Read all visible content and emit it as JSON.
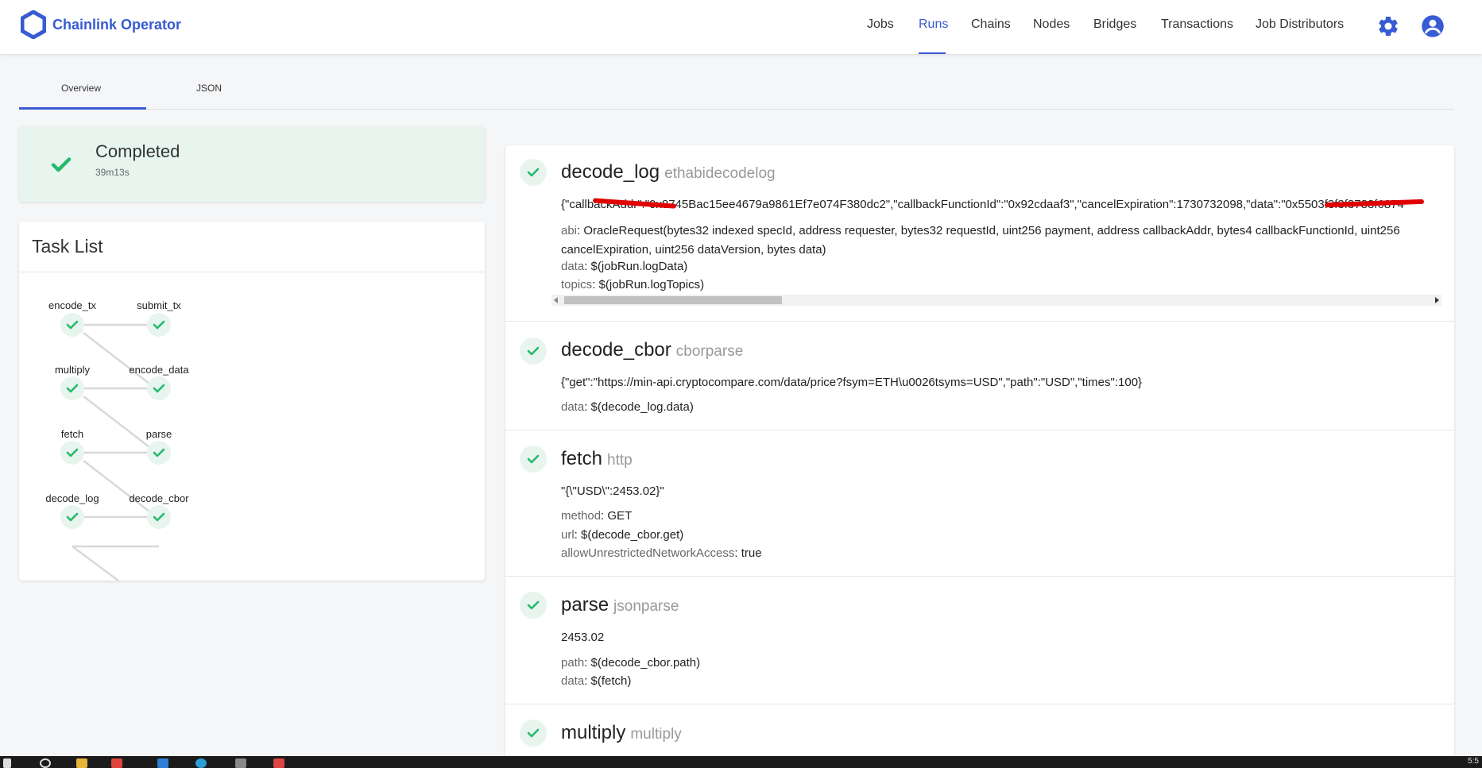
{
  "app": {
    "name": "Chainlink Operator"
  },
  "nav": {
    "items": [
      "Jobs",
      "Runs",
      "Chains",
      "Nodes",
      "Bridges",
      "Transactions",
      "Job Distributors"
    ],
    "active": "Runs"
  },
  "tabs": [
    "Overview",
    "JSON"
  ],
  "status": {
    "label": "Completed",
    "duration": "39m13s"
  },
  "tasklist": {
    "title": "Task List",
    "nodes": [
      "encode_tx",
      "submit_tx",
      "multiply",
      "encode_data",
      "fetch",
      "parse",
      "decode_log",
      "decode_cbor"
    ]
  },
  "tasks": [
    {
      "name": "decode_log",
      "type": "ethabidecodelog",
      "output": "{\"callbackAddr\":\"0x8745Bac15ee4679a9861Ef7e074F380dc2\",\"callbackFunctionId\":\"0x92cdaaf3\",\"cancelExpiration\":1730732098,\"data\":\"0x5503f3f3f3783f6874",
      "params": [
        {
          "key": "abi",
          "value": "OracleRequest(bytes32 indexed specId, address requester, bytes32 requestId, uint256 payment, address callbackAddr, bytes4 callbackFunctionId, uint256 cancelExpiration, uint256 dataVersion, bytes data)"
        },
        {
          "key": "data",
          "value": "$(jobRun.logData)"
        },
        {
          "key": "topics",
          "value": "$(jobRun.logTopics)"
        }
      ]
    },
    {
      "name": "decode_cbor",
      "type": "cborparse",
      "output": "{\"get\":\"https://min-api.cryptocompare.com/data/price?fsym=ETH\\u0026tsyms=USD\",\"path\":\"USD\",\"times\":100}",
      "params": [
        {
          "key": "data",
          "value": "$(decode_log.data)"
        }
      ]
    },
    {
      "name": "fetch",
      "type": "http",
      "output": "\"{\\\"USD\\\":2453.02}\"",
      "params": [
        {
          "key": "method",
          "value": "GET"
        },
        {
          "key": "url",
          "value": "$(decode_cbor.get)"
        },
        {
          "key": "allowUnrestrictedNetworkAccess",
          "value": "true"
        }
      ]
    },
    {
      "name": "parse",
      "type": "jsonparse",
      "output": "2453.02",
      "params": [
        {
          "key": "path",
          "value": "$(decode_cbor.path)"
        },
        {
          "key": "data",
          "value": "$(fetch)"
        }
      ]
    },
    {
      "name": "multiply",
      "type": "multiply"
    }
  ],
  "colors": {
    "accent": "#375bd2",
    "success": "#26b96e",
    "success_bg": "#e7f5ee"
  },
  "icons": [
    "chainlink-logo-icon",
    "settings-gear-icon",
    "account-circle-icon",
    "check-icon"
  ],
  "taskbar": {
    "clock": "5:5"
  }
}
